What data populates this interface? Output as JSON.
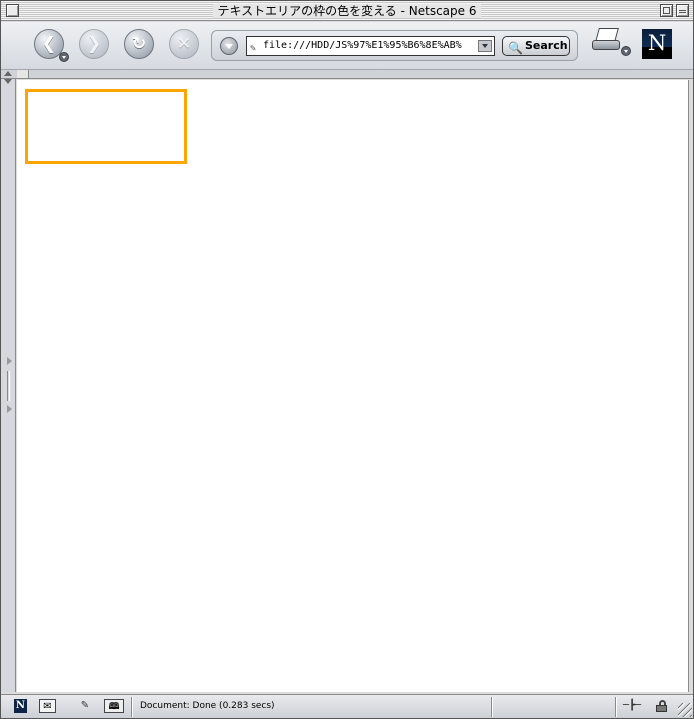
{
  "window": {
    "title": "テキストエリアの枠の色を変える - Netscape 6"
  },
  "toolbar": {
    "back_icon": "back-arrow-icon",
    "forward_icon": "forward-arrow-icon",
    "reload_icon": "reload-icon",
    "stop_icon": "stop-icon",
    "url": "file:///HDD/JS%97%E1%95%B6%8E%AB%",
    "search_label": "Search",
    "search_icon": "magnifier-icon",
    "print_icon": "printer-icon",
    "logo": "N"
  },
  "page": {
    "textarea_border_color": "#ffa500"
  },
  "statusbar": {
    "status": "Document: Done (0.283 secs)",
    "addr_label": "🕮"
  }
}
